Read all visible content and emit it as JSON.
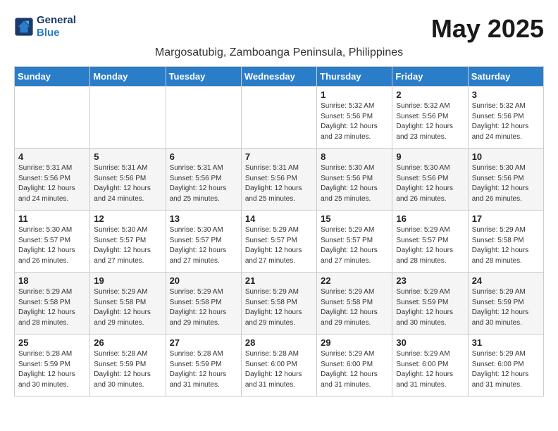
{
  "header": {
    "logo_line1": "General",
    "logo_line2": "Blue",
    "month_title": "May 2025",
    "subtitle": "Margosatubig, Zamboanga Peninsula, Philippines"
  },
  "days_of_week": [
    "Sunday",
    "Monday",
    "Tuesday",
    "Wednesday",
    "Thursday",
    "Friday",
    "Saturday"
  ],
  "weeks": [
    [
      {
        "day": "",
        "info": ""
      },
      {
        "day": "",
        "info": ""
      },
      {
        "day": "",
        "info": ""
      },
      {
        "day": "",
        "info": ""
      },
      {
        "day": "1",
        "info": "Sunrise: 5:32 AM\nSunset: 5:56 PM\nDaylight: 12 hours\nand 23 minutes."
      },
      {
        "day": "2",
        "info": "Sunrise: 5:32 AM\nSunset: 5:56 PM\nDaylight: 12 hours\nand 23 minutes."
      },
      {
        "day": "3",
        "info": "Sunrise: 5:32 AM\nSunset: 5:56 PM\nDaylight: 12 hours\nand 24 minutes."
      }
    ],
    [
      {
        "day": "4",
        "info": "Sunrise: 5:31 AM\nSunset: 5:56 PM\nDaylight: 12 hours\nand 24 minutes."
      },
      {
        "day": "5",
        "info": "Sunrise: 5:31 AM\nSunset: 5:56 PM\nDaylight: 12 hours\nand 24 minutes."
      },
      {
        "day": "6",
        "info": "Sunrise: 5:31 AM\nSunset: 5:56 PM\nDaylight: 12 hours\nand 25 minutes."
      },
      {
        "day": "7",
        "info": "Sunrise: 5:31 AM\nSunset: 5:56 PM\nDaylight: 12 hours\nand 25 minutes."
      },
      {
        "day": "8",
        "info": "Sunrise: 5:30 AM\nSunset: 5:56 PM\nDaylight: 12 hours\nand 25 minutes."
      },
      {
        "day": "9",
        "info": "Sunrise: 5:30 AM\nSunset: 5:56 PM\nDaylight: 12 hours\nand 26 minutes."
      },
      {
        "day": "10",
        "info": "Sunrise: 5:30 AM\nSunset: 5:56 PM\nDaylight: 12 hours\nand 26 minutes."
      }
    ],
    [
      {
        "day": "11",
        "info": "Sunrise: 5:30 AM\nSunset: 5:57 PM\nDaylight: 12 hours\nand 26 minutes."
      },
      {
        "day": "12",
        "info": "Sunrise: 5:30 AM\nSunset: 5:57 PM\nDaylight: 12 hours\nand 27 minutes."
      },
      {
        "day": "13",
        "info": "Sunrise: 5:30 AM\nSunset: 5:57 PM\nDaylight: 12 hours\nand 27 minutes."
      },
      {
        "day": "14",
        "info": "Sunrise: 5:29 AM\nSunset: 5:57 PM\nDaylight: 12 hours\nand 27 minutes."
      },
      {
        "day": "15",
        "info": "Sunrise: 5:29 AM\nSunset: 5:57 PM\nDaylight: 12 hours\nand 27 minutes."
      },
      {
        "day": "16",
        "info": "Sunrise: 5:29 AM\nSunset: 5:57 PM\nDaylight: 12 hours\nand 28 minutes."
      },
      {
        "day": "17",
        "info": "Sunrise: 5:29 AM\nSunset: 5:58 PM\nDaylight: 12 hours\nand 28 minutes."
      }
    ],
    [
      {
        "day": "18",
        "info": "Sunrise: 5:29 AM\nSunset: 5:58 PM\nDaylight: 12 hours\nand 28 minutes."
      },
      {
        "day": "19",
        "info": "Sunrise: 5:29 AM\nSunset: 5:58 PM\nDaylight: 12 hours\nand 29 minutes."
      },
      {
        "day": "20",
        "info": "Sunrise: 5:29 AM\nSunset: 5:58 PM\nDaylight: 12 hours\nand 29 minutes."
      },
      {
        "day": "21",
        "info": "Sunrise: 5:29 AM\nSunset: 5:58 PM\nDaylight: 12 hours\nand 29 minutes."
      },
      {
        "day": "22",
        "info": "Sunrise: 5:29 AM\nSunset: 5:58 PM\nDaylight: 12 hours\nand 29 minutes."
      },
      {
        "day": "23",
        "info": "Sunrise: 5:29 AM\nSunset: 5:59 PM\nDaylight: 12 hours\nand 30 minutes."
      },
      {
        "day": "24",
        "info": "Sunrise: 5:29 AM\nSunset: 5:59 PM\nDaylight: 12 hours\nand 30 minutes."
      }
    ],
    [
      {
        "day": "25",
        "info": "Sunrise: 5:28 AM\nSunset: 5:59 PM\nDaylight: 12 hours\nand 30 minutes."
      },
      {
        "day": "26",
        "info": "Sunrise: 5:28 AM\nSunset: 5:59 PM\nDaylight: 12 hours\nand 30 minutes."
      },
      {
        "day": "27",
        "info": "Sunrise: 5:28 AM\nSunset: 5:59 PM\nDaylight: 12 hours\nand 31 minutes."
      },
      {
        "day": "28",
        "info": "Sunrise: 5:28 AM\nSunset: 6:00 PM\nDaylight: 12 hours\nand 31 minutes."
      },
      {
        "day": "29",
        "info": "Sunrise: 5:29 AM\nSunset: 6:00 PM\nDaylight: 12 hours\nand 31 minutes."
      },
      {
        "day": "30",
        "info": "Sunrise: 5:29 AM\nSunset: 6:00 PM\nDaylight: 12 hours\nand 31 minutes."
      },
      {
        "day": "31",
        "info": "Sunrise: 5:29 AM\nSunset: 6:00 PM\nDaylight: 12 hours\nand 31 minutes."
      }
    ]
  ]
}
